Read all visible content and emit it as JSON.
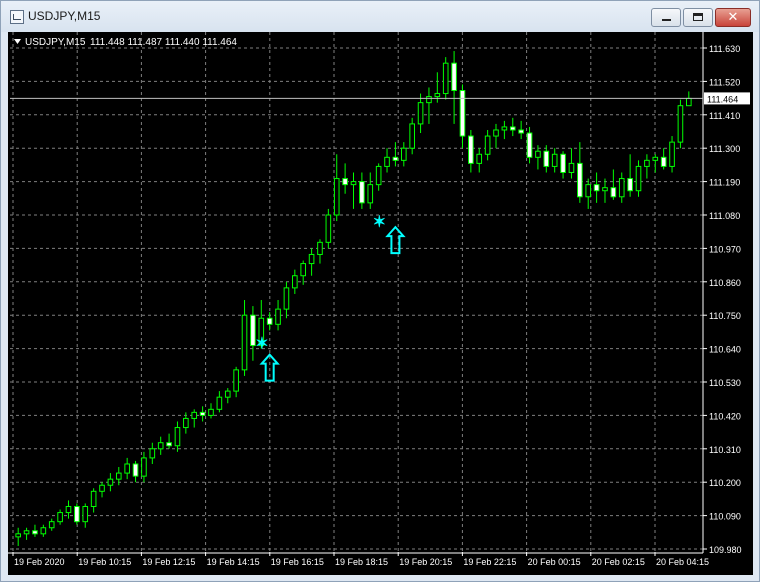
{
  "window": {
    "title": "USDJPY,M15",
    "close_symbol": "✕"
  },
  "chart_header": {
    "symbol_label": "USDJPY,M15",
    "ohlc_text": "111.448 111.487 111.440 111.464"
  },
  "colors": {
    "background": "#000000",
    "grid": "#7f7f7f",
    "candle": "#00ff00",
    "marker": "#00ffff",
    "text": "#ffffff"
  },
  "chart_data": {
    "type": "candlestick",
    "ylim": [
      109.98,
      111.7
    ],
    "y_ticks": [
      111.63,
      111.52,
      111.41,
      111.3,
      111.19,
      111.08,
      110.97,
      110.86,
      110.75,
      110.64,
      110.53,
      110.42,
      110.31,
      110.2,
      110.09,
      109.98
    ],
    "x_ticks": [
      "19 Feb 2020",
      "19 Feb 10:15",
      "19 Feb 12:15",
      "19 Feb 14:15",
      "19 Feb 16:15",
      "19 Feb 18:15",
      "19 Feb 20:15",
      "19 Feb 22:15",
      "20 Feb 00:15",
      "20 Feb 02:15",
      "20 Feb 04:15"
    ],
    "current_price": "111.464",
    "candles": [
      [
        110.02,
        110.05,
        109.99,
        110.03
      ],
      [
        110.03,
        110.05,
        110.01,
        110.04
      ],
      [
        110.04,
        110.06,
        110.02,
        110.03
      ],
      [
        110.03,
        110.06,
        110.02,
        110.05
      ],
      [
        110.05,
        110.08,
        110.04,
        110.07
      ],
      [
        110.07,
        110.11,
        110.06,
        110.1
      ],
      [
        110.1,
        110.14,
        110.08,
        110.12
      ],
      [
        110.12,
        110.13,
        110.06,
        110.07
      ],
      [
        110.07,
        110.13,
        110.05,
        110.12
      ],
      [
        110.12,
        110.18,
        110.1,
        110.17
      ],
      [
        110.17,
        110.2,
        110.15,
        110.19
      ],
      [
        110.19,
        110.23,
        110.17,
        110.21
      ],
      [
        110.21,
        110.25,
        110.19,
        110.23
      ],
      [
        110.23,
        110.28,
        110.21,
        110.26
      ],
      [
        110.26,
        110.27,
        110.2,
        110.22
      ],
      [
        110.22,
        110.3,
        110.2,
        110.28
      ],
      [
        110.28,
        110.33,
        110.26,
        110.31
      ],
      [
        110.31,
        110.35,
        110.29,
        110.33
      ],
      [
        110.33,
        110.36,
        110.31,
        110.32
      ],
      [
        110.32,
        110.4,
        110.3,
        110.38
      ],
      [
        110.38,
        110.43,
        110.36,
        110.41
      ],
      [
        110.41,
        110.44,
        110.38,
        110.43
      ],
      [
        110.43,
        110.45,
        110.4,
        110.42
      ],
      [
        110.42,
        110.46,
        110.41,
        110.44
      ],
      [
        110.44,
        110.5,
        110.43,
        110.48
      ],
      [
        110.48,
        110.51,
        110.46,
        110.5
      ],
      [
        110.5,
        110.58,
        110.48,
        110.57
      ],
      [
        110.57,
        110.8,
        110.55,
        110.75
      ],
      [
        110.75,
        110.78,
        110.6,
        110.65
      ],
      [
        110.65,
        110.8,
        110.64,
        110.74
      ],
      [
        110.74,
        110.76,
        110.7,
        110.72
      ],
      [
        110.72,
        110.8,
        110.7,
        110.77
      ],
      [
        110.77,
        110.86,
        110.74,
        110.84
      ],
      [
        110.84,
        110.9,
        110.82,
        110.88
      ],
      [
        110.88,
        110.93,
        110.85,
        110.92
      ],
      [
        110.92,
        110.97,
        110.88,
        110.95
      ],
      [
        110.95,
        111.0,
        110.92,
        110.99
      ],
      [
        110.99,
        111.1,
        110.97,
        111.08
      ],
      [
        111.08,
        111.28,
        111.06,
        111.2
      ],
      [
        111.2,
        111.25,
        111.15,
        111.18
      ],
      [
        111.18,
        111.22,
        111.1,
        111.19
      ],
      [
        111.19,
        111.22,
        111.1,
        111.12
      ],
      [
        111.12,
        111.22,
        111.1,
        111.18
      ],
      [
        111.18,
        111.25,
        111.16,
        111.24
      ],
      [
        111.24,
        111.3,
        111.22,
        111.27
      ],
      [
        111.27,
        111.32,
        111.24,
        111.26
      ],
      [
        111.26,
        111.32,
        111.24,
        111.3
      ],
      [
        111.3,
        111.4,
        111.28,
        111.38
      ],
      [
        111.38,
        111.48,
        111.35,
        111.45
      ],
      [
        111.45,
        111.5,
        111.38,
        111.47
      ],
      [
        111.47,
        111.55,
        111.45,
        111.48
      ],
      [
        111.48,
        111.6,
        111.46,
        111.58
      ],
      [
        111.58,
        111.62,
        111.38,
        111.49
      ],
      [
        111.49,
        111.51,
        111.3,
        111.34
      ],
      [
        111.34,
        111.36,
        111.22,
        111.25
      ],
      [
        111.25,
        111.3,
        111.22,
        111.28
      ],
      [
        111.28,
        111.36,
        111.26,
        111.34
      ],
      [
        111.34,
        111.38,
        111.3,
        111.36
      ],
      [
        111.36,
        111.39,
        111.33,
        111.37
      ],
      [
        111.37,
        111.4,
        111.34,
        111.36
      ],
      [
        111.36,
        111.39,
        111.33,
        111.35
      ],
      [
        111.35,
        111.37,
        111.25,
        111.27
      ],
      [
        111.27,
        111.31,
        111.23,
        111.29
      ],
      [
        111.29,
        111.31,
        111.22,
        111.24
      ],
      [
        111.24,
        111.3,
        111.22,
        111.28
      ],
      [
        111.28,
        111.29,
        111.2,
        111.22
      ],
      [
        111.22,
        111.3,
        111.2,
        111.25
      ],
      [
        111.25,
        111.32,
        111.12,
        111.14
      ],
      [
        111.14,
        111.2,
        111.1,
        111.18
      ],
      [
        111.18,
        111.22,
        111.12,
        111.16
      ],
      [
        111.16,
        111.2,
        111.12,
        111.17
      ],
      [
        111.17,
        111.23,
        111.13,
        111.14
      ],
      [
        111.14,
        111.22,
        111.12,
        111.2
      ],
      [
        111.2,
        111.28,
        111.14,
        111.16
      ],
      [
        111.16,
        111.26,
        111.14,
        111.24
      ],
      [
        111.24,
        111.28,
        111.2,
        111.26
      ],
      [
        111.26,
        111.28,
        111.22,
        111.27
      ],
      [
        111.27,
        111.3,
        111.23,
        111.24
      ],
      [
        111.24,
        111.34,
        111.22,
        111.32
      ],
      [
        111.32,
        111.46,
        111.3,
        111.44
      ],
      [
        111.44,
        111.487,
        111.44,
        111.464
      ]
    ],
    "markers": [
      {
        "label": "star",
        "x_index": 29,
        "price": 110.66
      },
      {
        "label": "up-arrow",
        "x_index": 30,
        "price": 110.62
      },
      {
        "label": "star",
        "x_index": 43,
        "price": 111.06
      },
      {
        "label": "up-arrow",
        "x_index": 45,
        "price": 111.04
      }
    ]
  }
}
